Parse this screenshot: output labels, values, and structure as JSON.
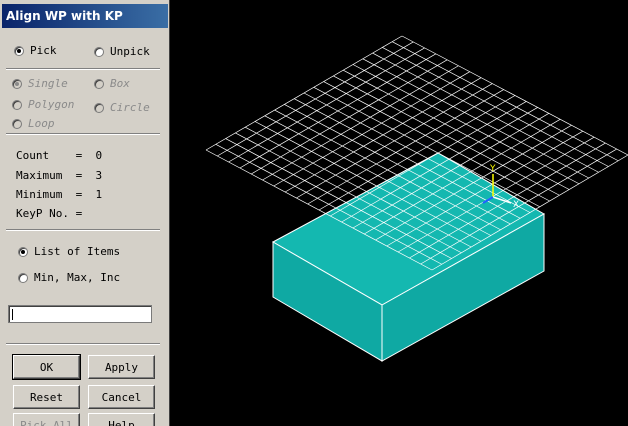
{
  "dialog": {
    "title": "Align WP with KP",
    "pick_label": "Pick",
    "unpick_label": "Unpick",
    "modes": {
      "single": "Single",
      "box": "Box",
      "polygon": "Polygon",
      "circle": "Circle",
      "loop": "Loop"
    },
    "info": {
      "count": "Count    =  0",
      "maximum": "Maximum  =  3",
      "minimum": "Minimum  =  1",
      "keyp": "KeyP No. ="
    },
    "list_items_label": "List of Items",
    "min_max_inc_label": "Min, Max, Inc",
    "entry_value": "",
    "buttons": {
      "ok": "OK",
      "apply": "Apply",
      "reset": "Reset",
      "cancel": "Cancel",
      "pick_all": "Pick All",
      "help": "Help"
    }
  },
  "viewport": {
    "workplane_color": "#ffffff",
    "block_top_color": "#14b8b0",
    "block_side_color": "#0fa9a3",
    "axis": {
      "y": "Y",
      "x": "X"
    },
    "axis_colors": {
      "y": "#ffff00",
      "x": "#ffffff",
      "z": "#2060ff"
    }
  }
}
